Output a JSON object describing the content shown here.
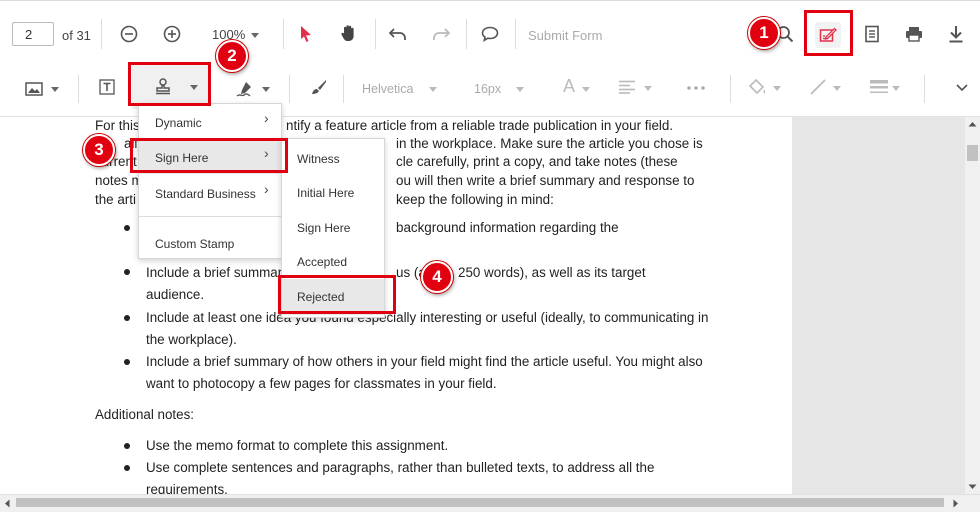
{
  "toolbar": {
    "page_input_value": "2",
    "page_of": "of 31",
    "zoom_value": "100%",
    "submit_form": "Submit Form"
  },
  "annotation_toolbar": {
    "font_family": "Helvetica",
    "font_size": "16px",
    "font_color_glyph": "A"
  },
  "stamp_menu": {
    "items": [
      {
        "label": "Dynamic"
      },
      {
        "label": "Sign Here"
      },
      {
        "label": "Standard Business"
      },
      {
        "label": "Custom Stamp"
      }
    ]
  },
  "sign_here_submenu": {
    "items": [
      {
        "label": "Witness"
      },
      {
        "label": "Initial Here"
      },
      {
        "label": "Sign Here"
      },
      {
        "label": "Accepted"
      },
      {
        "label": "Rejected"
      }
    ]
  },
  "callouts": [
    "1",
    "2",
    "3",
    "4"
  ],
  "document": {
    "lines": {
      "l1a": "For this",
      "l1b": "ntify a feature article from a reliable trade publication in your field.",
      "l2a": "ally,",
      "l2b": "in the workplace. Make sure the article you chose is",
      "l3a": "current",
      "l3b": "cle carefully, print a copy, and take notes (these",
      "l4a": "notes m",
      "l4b": "ou will then write a brief summary and response to",
      "l5a": "the arti",
      "l5b": "keep the following in mind:",
      "b1": "background information regarding the",
      "b2a": "Include a brief summar",
      "b2b": "us (a",
      "b2c": "250 words), as well as its target",
      "b2d": "audience.",
      "b3a": "Include at least one idea you found especially interesting or useful (ideally, to communicating in",
      "b3b": "the workplace).",
      "b4a": "Include a brief summary of how others in your field might find the article useful. You might also",
      "b4b": "want to photocopy a few pages for classmates in your field.",
      "notes": "Additional notes:",
      "n1": "Use the memo format to complete this assignment.",
      "n2a": "Use complete sentences and paragraphs, rather than bulleted texts, to address all the",
      "n2b": "requirements."
    }
  },
  "colors": {
    "callout_red": "#e0000f",
    "cursor_pink": "#e0304a"
  }
}
